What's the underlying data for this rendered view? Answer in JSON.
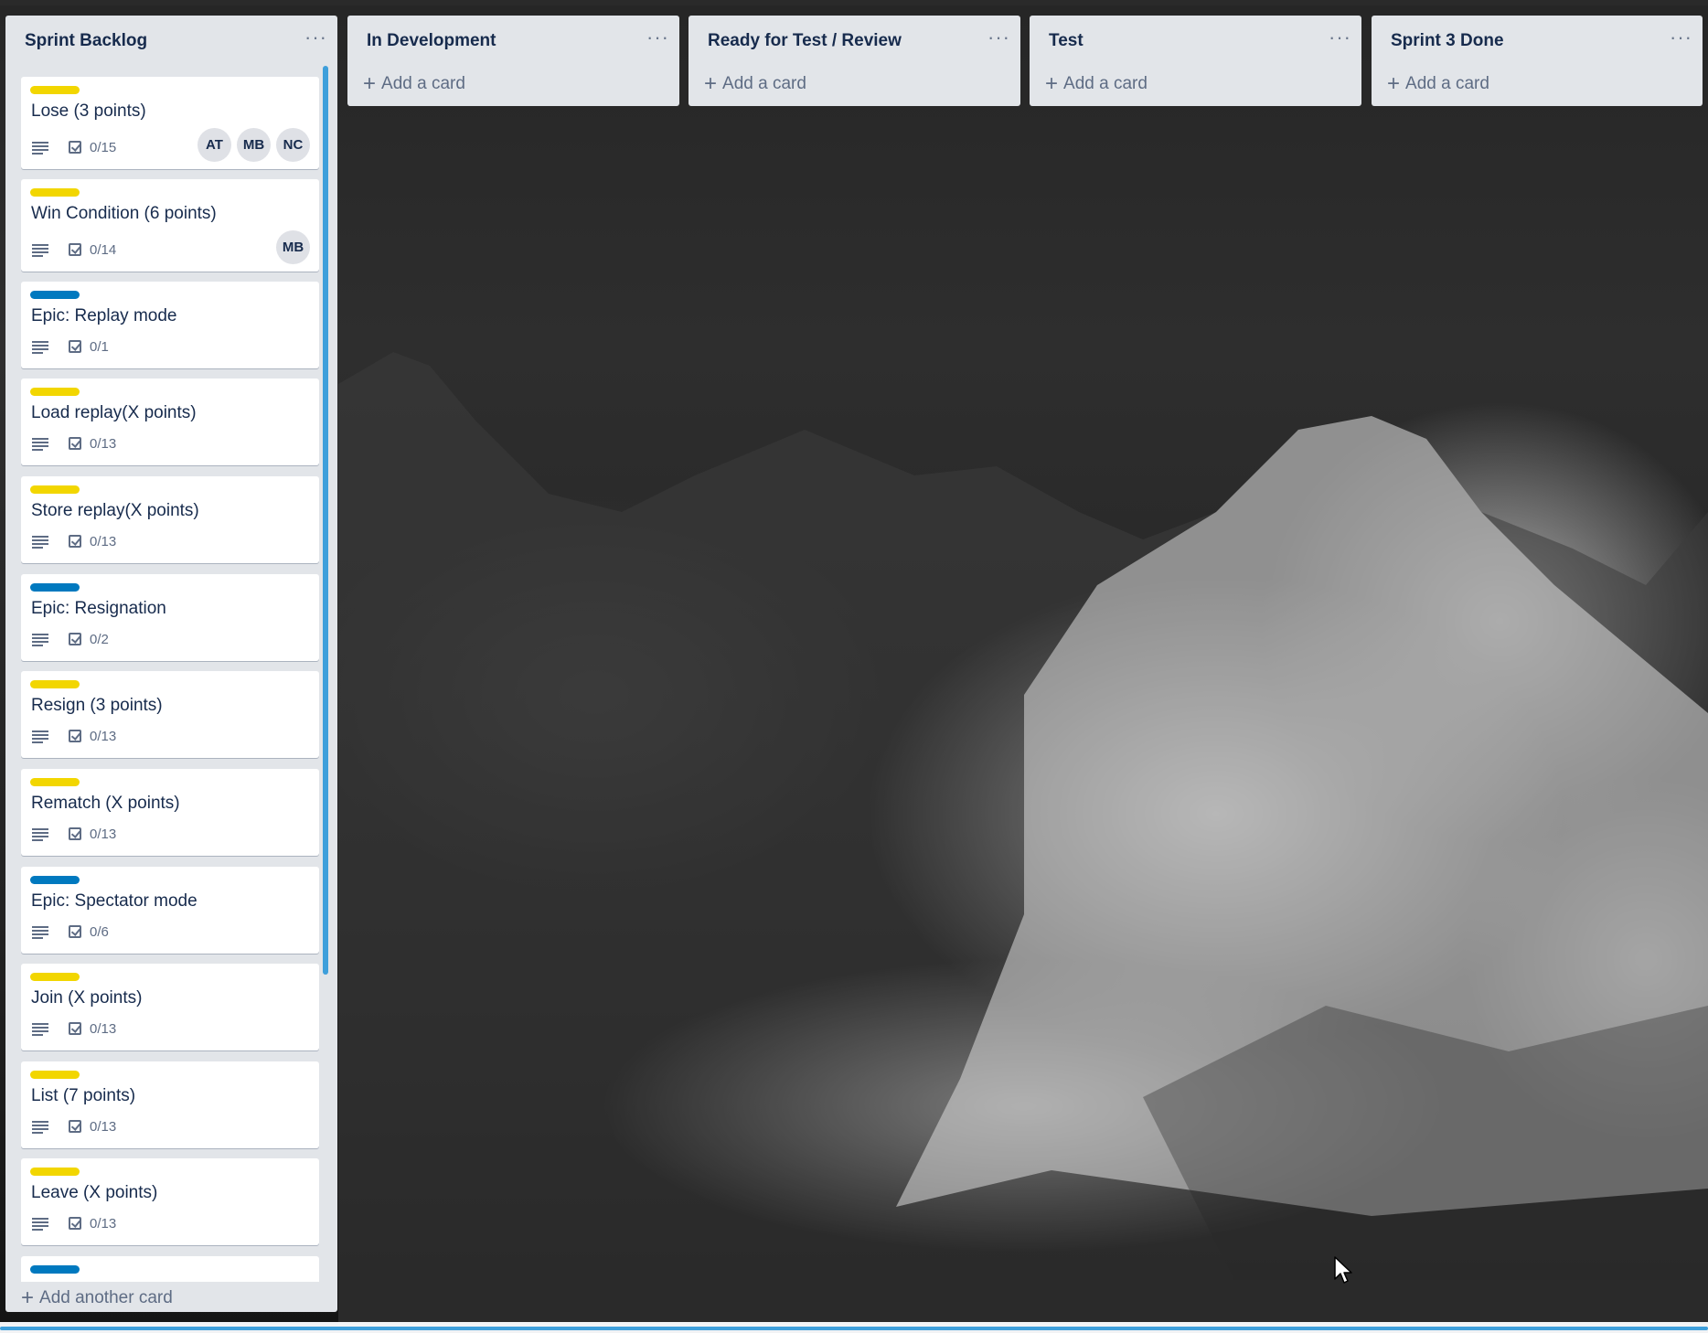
{
  "colors": {
    "label_yellow": "#f2d600",
    "label_blue": "#0079bf",
    "list_bg": "#e2e5e9",
    "scrollbar": "#3e9fdb"
  },
  "lists": [
    {
      "title": "Sprint Backlog",
      "add_label": "Add another card"
    },
    {
      "title": "In Development",
      "add_label": "Add a card"
    },
    {
      "title": "Ready for Test / Review",
      "add_label": "Add a card"
    },
    {
      "title": "Test",
      "add_label": "Add a card"
    },
    {
      "title": "Sprint 3 Done",
      "add_label": "Add a card"
    }
  ],
  "backlog_cards": [
    {
      "label": "yellow",
      "title": "Lose (3 points)",
      "checklist": "0/15",
      "members": [
        "AT",
        "MB",
        "NC"
      ]
    },
    {
      "label": "yellow",
      "title": "Win Condition (6 points)",
      "checklist": "0/14",
      "members": [
        "MB"
      ]
    },
    {
      "label": "blue",
      "title": "Epic: Replay mode",
      "checklist": "0/1",
      "members": []
    },
    {
      "label": "yellow",
      "title": "Load replay(X points)",
      "checklist": "0/13",
      "members": []
    },
    {
      "label": "yellow",
      "title": "Store replay(X points)",
      "checklist": "0/13",
      "members": []
    },
    {
      "label": "blue",
      "title": "Epic: Resignation",
      "checklist": "0/2",
      "members": []
    },
    {
      "label": "yellow",
      "title": "Resign (3 points)",
      "checklist": "0/13",
      "members": []
    },
    {
      "label": "yellow",
      "title": "Rematch (X points)",
      "checklist": "0/13",
      "members": []
    },
    {
      "label": "blue",
      "title": "Epic: Spectator mode",
      "checklist": "0/6",
      "members": []
    },
    {
      "label": "yellow",
      "title": "Join (X points)",
      "checklist": "0/13",
      "members": []
    },
    {
      "label": "yellow",
      "title": "List (7 points)",
      "checklist": "0/13",
      "members": []
    },
    {
      "label": "yellow",
      "title": "Leave (X points)",
      "checklist": "0/13",
      "members": []
    },
    {
      "label": "blue",
      "title": "",
      "checklist": "",
      "members": []
    }
  ]
}
